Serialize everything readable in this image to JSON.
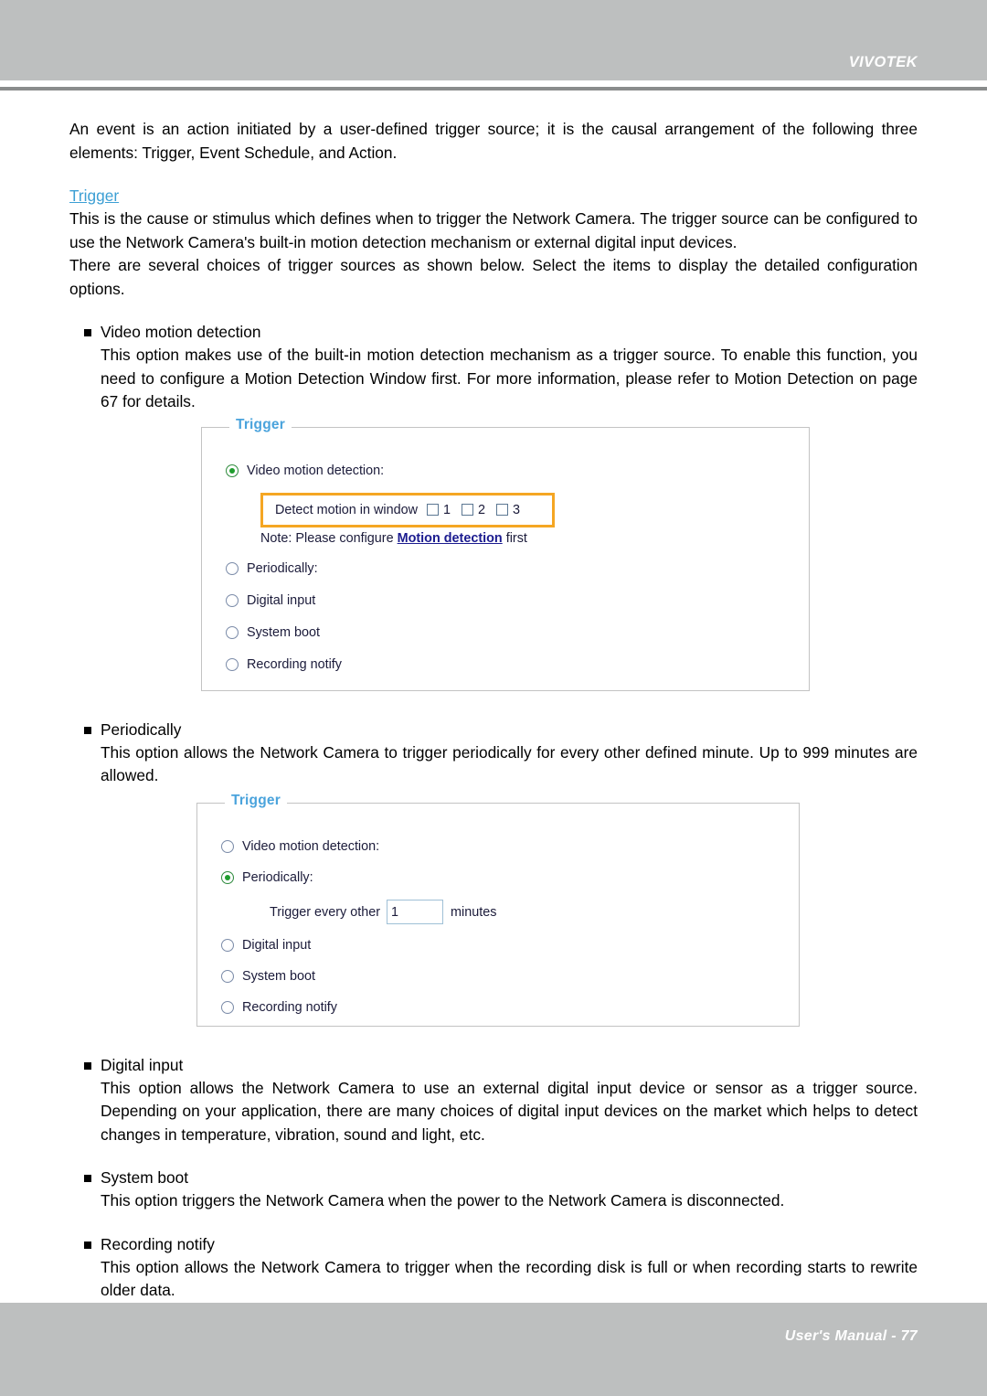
{
  "header": {
    "brand": "VIVOTEK"
  },
  "footer": {
    "text": "User's Manual - 77"
  },
  "intro": {
    "paragraph": "An event is an action initiated by a user-defined trigger source; it is the causal arrangement of the following three elements: Trigger, Event Schedule, and Action."
  },
  "trigger_section": {
    "heading": "Trigger",
    "paragraph1": "This is the cause or stimulus which defines when to trigger the Network Camera. The trigger source can be configured to use the Network Camera's built-in motion detection mechanism or external digital input devices.",
    "paragraph2": "There are several choices of trigger sources as shown below. Select the items to display the detailed configuration options."
  },
  "bullets": [
    {
      "title": "Video motion detection",
      "body": "This option makes use of the built-in motion detection mechanism as a trigger source. To enable this function, you need to configure a Motion Detection Window first. For more information, please refer to Motion Detection on page 67 for details."
    },
    {
      "title": "Periodically",
      "body": "This option allows the Network Camera to trigger periodically for every other defined minute. Up to 999 minutes are allowed."
    },
    {
      "title": "Digital input",
      "body": "This option allows the Network Camera to use an external digital input device or sensor as a trigger source. Depending on your application, there are many choices of digital input devices on the market which helps to detect changes in temperature, vibration, sound and light, etc."
    },
    {
      "title": "System boot",
      "body": "This option triggers the Network Camera when the power to the Network Camera is disconnected."
    },
    {
      "title": "Recording notify",
      "body": "This option allows the Network Camera to trigger when the recording disk is full or when recording starts to rewrite older data."
    }
  ],
  "panel1": {
    "legend": "Trigger",
    "options": [
      {
        "label": "Video motion detection:",
        "selected": true
      },
      {
        "label": "Periodically:",
        "selected": false
      },
      {
        "label": "Digital input",
        "selected": false
      },
      {
        "label": "System boot",
        "selected": false
      },
      {
        "label": "Recording notify",
        "selected": false
      }
    ],
    "detect_row": {
      "label": "Detect motion in window",
      "checkboxes": [
        "1",
        "2",
        "3"
      ],
      "highlight_color": "#f5a623"
    },
    "note": {
      "prefix": "Note: Please configure ",
      "link": "Motion detection",
      "suffix": " first"
    }
  },
  "panel2": {
    "legend": "Trigger",
    "options": [
      {
        "label": "Video motion detection:",
        "selected": false
      },
      {
        "label": "Periodically:",
        "selected": true
      },
      {
        "label": "Digital input",
        "selected": false
      },
      {
        "label": "System boot",
        "selected": false
      },
      {
        "label": "Recording notify",
        "selected": false
      }
    ],
    "period_row": {
      "label": "Trigger every other",
      "value": "1",
      "unit": "minutes"
    }
  },
  "colors": {
    "chrome_gray": "#bdbfbf",
    "rule_gray": "#8a8c8c",
    "link_blue": "#3c9fd4",
    "legend_blue": "#4aa3dc",
    "radio_green": "#1f9d2e",
    "highlight_orange": "#f5a623"
  }
}
